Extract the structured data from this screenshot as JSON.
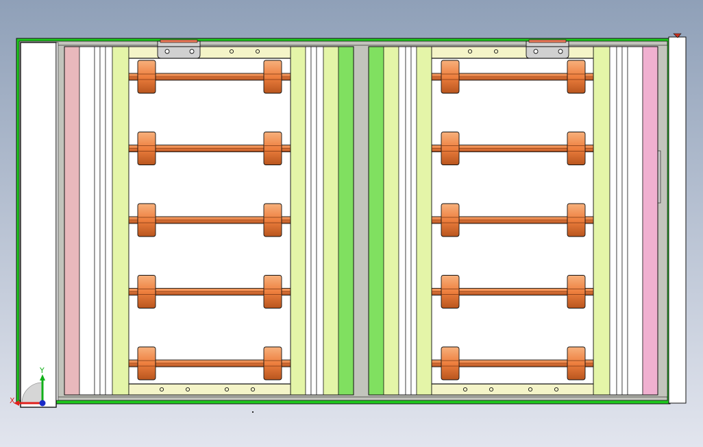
{
  "viewport": {
    "background_top": "#8fa0b8",
    "background_bottom": "#e2e5ee"
  },
  "triad": {
    "x_label": "X",
    "y_label": "Y",
    "x_color": "#e0201c",
    "y_color": "#12b01a",
    "origin_color": "#1a2ac8"
  },
  "colors": {
    "outline": "#111111",
    "frame_green": "#1ec81e",
    "frame_gray": "#c2c4bc",
    "white_panel": "#ffffff",
    "pink_rail": "#e8b8bc",
    "magenta_rail": "#f0b0d0",
    "light_green": "#e4f5a8",
    "lime_green": "#80e060",
    "bar_yellow": "#f4f4c8",
    "roller_copper": "#f08a48",
    "roller_dark": "#b04e1c",
    "bracket_gray": "#d0d0d0",
    "bracket_accent": "#e87858"
  },
  "left_conveyor": {
    "roller_count": 5,
    "hole_count_top": 2,
    "hole_count_bottom": 4
  },
  "right_conveyor": {
    "roller_count": 5,
    "hole_count_top": 2,
    "hole_count_bottom": 4
  }
}
